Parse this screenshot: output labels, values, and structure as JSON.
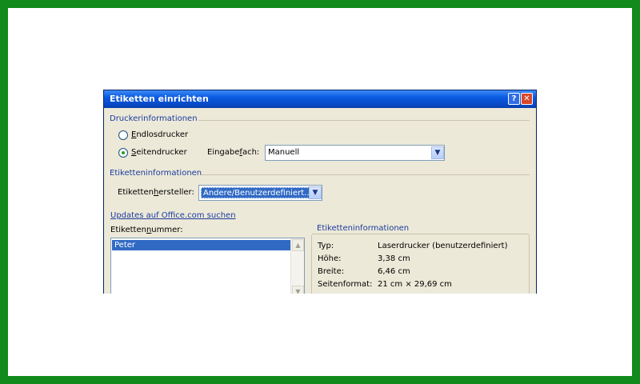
{
  "dialog": {
    "title": "Etiketten einrichten",
    "help_button": "?",
    "close_button": "✕"
  },
  "drucker": {
    "group_label": "Druckerinformationen",
    "radio_endlos": {
      "pre": "",
      "key": "E",
      "post": "ndlosdrucker",
      "checked": false
    },
    "radio_seiten": {
      "pre": "",
      "key": "S",
      "post": "eitendrucker",
      "checked": true
    },
    "eingabefach_label": {
      "pre": "Eingabe",
      "key": "f",
      "post": "ach:"
    },
    "eingabefach_value": "Manuell"
  },
  "etiketten": {
    "group_label": "Etiketteninformationen",
    "hersteller_label": {
      "pre": "Etiketten",
      "key": "h",
      "post": "ersteller:"
    },
    "hersteller_value": "Andere/Benutzerdefiniert..."
  },
  "updates_link": "Updates auf Office.com suchen",
  "nummer": {
    "label": {
      "pre": "Etiketten",
      "key": "n",
      "post": "ummer:"
    },
    "items": [
      "Peter"
    ],
    "selected": "Peter"
  },
  "info": {
    "group_label": "Etiketteninformationen",
    "rows": [
      {
        "key": "Typ:",
        "value": "Laserdrucker (benutzerdefiniert)"
      },
      {
        "key": "Höhe:",
        "value": "3,38 cm"
      },
      {
        "key": "Breite:",
        "value": "6,46 cm"
      },
      {
        "key": "Seitenformat:",
        "value": "21 cm × 29,69 cm"
      }
    ]
  },
  "colors": {
    "frame_border": "#138a1c",
    "titlebar": "#0a5ae0",
    "dialog_bg": "#ece9d8",
    "group_text": "#1b3b9f",
    "selection": "#316ac5"
  },
  "icons": {
    "dropdown": "chevron-down-icon",
    "scroll_up": "arrow-up-icon",
    "scroll_down": "arrow-down-icon"
  }
}
